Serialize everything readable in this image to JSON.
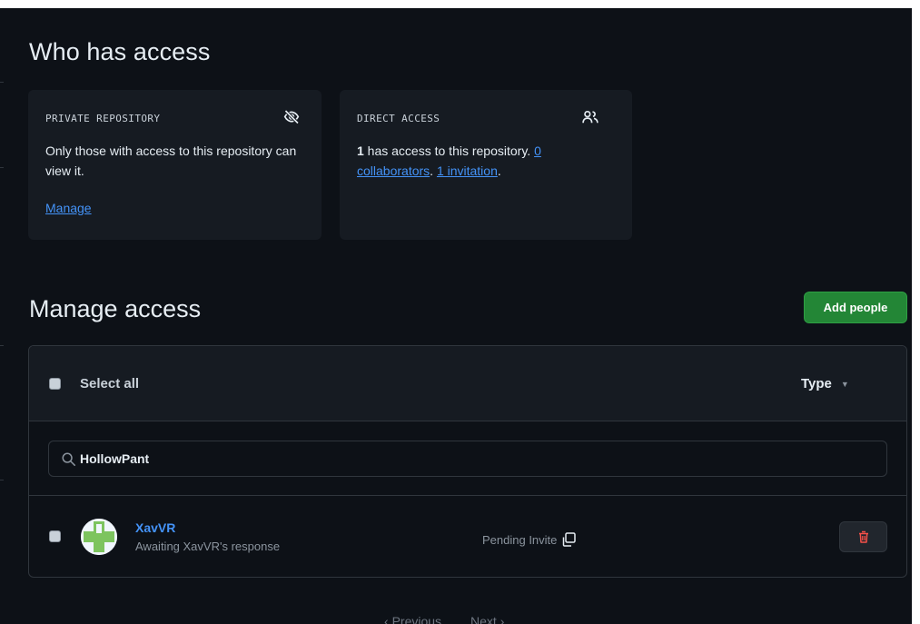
{
  "who_has_access": {
    "title": "Who has access",
    "private_card": {
      "label": "PRIVATE REPOSITORY",
      "icon": "eye-closed-icon",
      "text": "Only those with access to this repository can view it.",
      "manage_link": "Manage"
    },
    "direct_card": {
      "label": "DIRECT ACCESS",
      "icon": "people-icon",
      "count": "1",
      "text_after_count": " has access to this repository. ",
      "collaborators_link": "0 collaborators",
      "sep": ". ",
      "invitation_link": "1 invitation",
      "end": "."
    }
  },
  "manage_access": {
    "title": "Manage access",
    "add_button": "Add people",
    "select_all": "Select all",
    "type_filter": "Type",
    "search": {
      "value": "HollowPant",
      "icon": "search-icon"
    },
    "members": [
      {
        "name": "XavVR",
        "status": "Awaiting XavVR's response",
        "role": "Pending Invite",
        "avatar": "identicon-green-cross"
      }
    ]
  },
  "pagination": {
    "previous": "Previous",
    "next": "Next"
  },
  "colors": {
    "background": "#0d1117",
    "card": "#161b22",
    "link": "#4493f8",
    "primary_button": "#238636",
    "danger": "#f85149",
    "border": "#30363d"
  }
}
